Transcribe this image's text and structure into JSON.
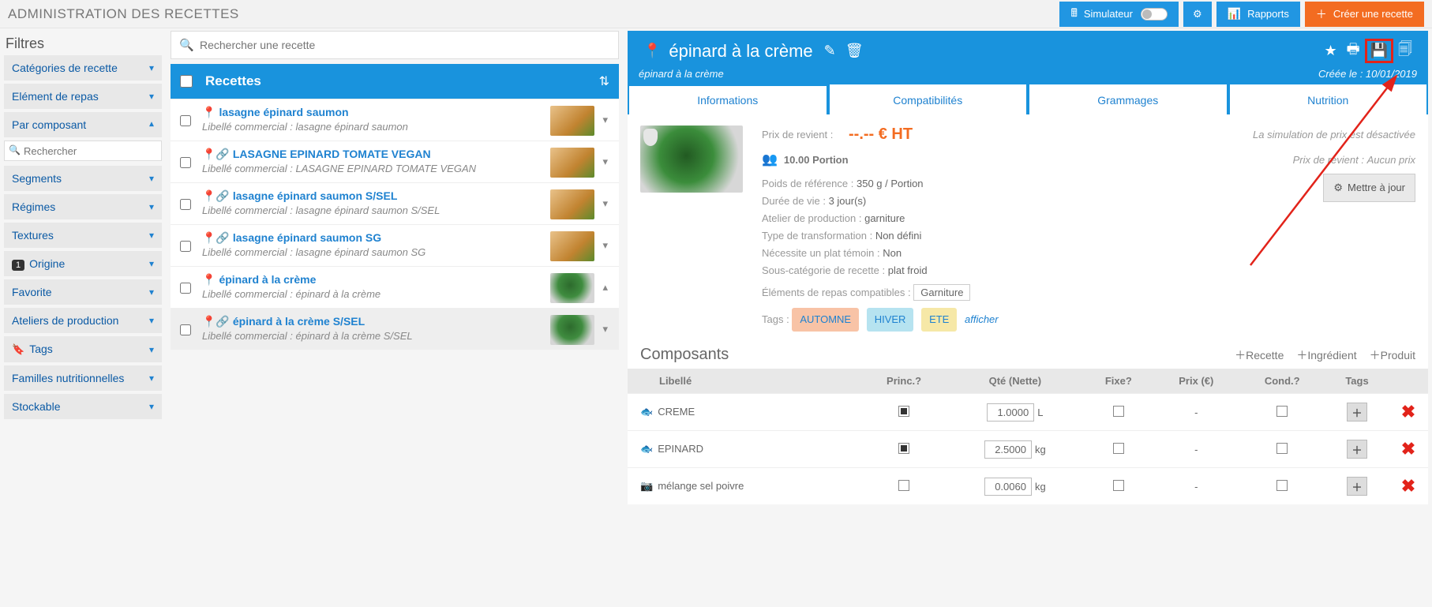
{
  "topbar": {
    "title": "ADMINISTRATION DES RECETTES",
    "simulateur": "Simulateur",
    "rapports": "Rapports",
    "creer": "Créer une recette"
  },
  "filters": {
    "heading": "Filtres",
    "search_placeholder": "Rechercher",
    "items": [
      {
        "label": "Catégories de recette",
        "state": "down"
      },
      {
        "label": "Elément de repas",
        "state": "down"
      },
      {
        "label": "Par composant",
        "state": "up"
      },
      {
        "label": "Segments",
        "state": "down"
      },
      {
        "label": "Régimes",
        "state": "down"
      },
      {
        "label": "Textures",
        "state": "down"
      },
      {
        "label": "Origine",
        "state": "down",
        "badge": "1"
      },
      {
        "label": "Favorite",
        "state": "down"
      },
      {
        "label": "Ateliers de production",
        "state": "down"
      },
      {
        "label": "Tags",
        "state": "down",
        "tag_icon": true
      },
      {
        "label": "Familles nutritionnelles",
        "state": "down"
      },
      {
        "label": "Stockable",
        "state": "down"
      }
    ]
  },
  "list": {
    "search_placeholder": "Rechercher une recette",
    "header": "Recettes",
    "sub_prefix": "Libellé commercial : ",
    "items": [
      {
        "name": "lasagne épinard saumon",
        "sub": "lasagne épinard saumon",
        "pins": 1
      },
      {
        "name": "LASAGNE EPINARD TOMATE VEGAN",
        "sub": "LASAGNE EPINARD TOMATE VEGAN",
        "pins": 2
      },
      {
        "name": "lasagne épinard saumon S/SEL",
        "sub": "lasagne épinard saumon S/SEL",
        "pins": 2
      },
      {
        "name": "lasagne épinard saumon SG",
        "sub": "lasagne épinard saumon SG",
        "pins": 2
      },
      {
        "name": "épinard à la crème",
        "sub": "épinard à la crème",
        "pins": 1,
        "green": true,
        "sel": true
      },
      {
        "name": "épinard à la crème S/SEL",
        "sub": "épinard à la crème S/SEL",
        "pins": 2,
        "green": true,
        "selrow": true
      }
    ]
  },
  "detail": {
    "title": "épinard à la crème",
    "subtitle": "épinard à la crème",
    "created": "Créée le : 10/01/2019",
    "tabs": [
      "Informations",
      "Compatibilités",
      "Grammages",
      "Nutrition"
    ],
    "cost_label": "Prix de revient :",
    "cost_value": "--.--   € HT",
    "sim_off": "La simulation de prix est désactivée",
    "portion_value": "10.00 Portion",
    "revient_lab": "Prix de revient :",
    "revient_val": "Aucun prix",
    "meta": {
      "poids_lab": "Poids de référence :",
      "poids_val": "350 g / Portion",
      "duree_lab": "Durée de vie :",
      "duree_val": "3 jour(s)",
      "atelier_lab": "Atelier de production :",
      "atelier_val": "garniture",
      "transf_lab": "Type de transformation :",
      "transf_val": "Non défini",
      "temoin_lab": "Nécessite un plat témoin :",
      "temoin_val": "Non",
      "souscat_lab": "Sous-catégorie de recette :",
      "souscat_val": "plat froid",
      "elem_lab": "Éléments de repas compatibles :",
      "elem_val": "Garniture",
      "tags_lab": "Tags :",
      "tag_autumn": "AUTOMNE",
      "tag_winter": "HIVER",
      "tag_summer": "ETE",
      "tag_more": "afficher"
    },
    "update_btn": "Mettre à jour"
  },
  "components": {
    "title": "Composants",
    "add_recette": "Recette",
    "add_ingredient": "Ingrédient",
    "add_produit": "Produit",
    "cols": {
      "lib": "Libellé",
      "princ": "Princ.?",
      "qte": "Qté (Nette)",
      "fixe": "Fixe?",
      "prix": "Prix (€)",
      "cond": "Cond.?",
      "tags": "Tags"
    },
    "rows": [
      {
        "name": "CREME",
        "icon": "fish",
        "princ": true,
        "qty": "1.0000",
        "unit": "L"
      },
      {
        "name": "EPINARD",
        "icon": "fish",
        "princ": true,
        "qty": "2.5000",
        "unit": "kg"
      },
      {
        "name": "mélange sel poivre",
        "icon": "jar",
        "princ": false,
        "qty": "0.0060",
        "unit": "kg"
      }
    ]
  }
}
